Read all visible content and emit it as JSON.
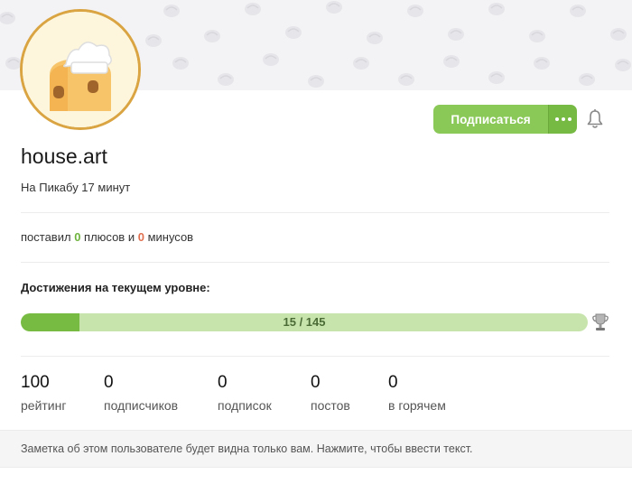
{
  "profile": {
    "username": "house.art",
    "since": "На Пикабу 17 минут"
  },
  "actions": {
    "subscribe_label": "Подписаться",
    "more_icon": "ellipsis-icon",
    "bell_icon": "bell-icon"
  },
  "votes": {
    "prefix": "поставил",
    "plus_count": "0",
    "plus_label": "плюсов и",
    "minus_count": "0",
    "minus_label": "минусов"
  },
  "achievements": {
    "title": "Достижения на текущем уровне:",
    "current": 15,
    "total": 145,
    "progress_text": "15 / 145",
    "trophy_icon": "trophy-icon"
  },
  "stats": [
    {
      "value": "100",
      "label": "рейтинг"
    },
    {
      "value": "0",
      "label": "подписчиков"
    },
    {
      "value": "0",
      "label": "подписок"
    },
    {
      "value": "0",
      "label": "постов"
    },
    {
      "value": "0",
      "label": "в горячем"
    }
  ],
  "note": {
    "text": "Заметка об этом пользователе будет видна только вам. Нажмите, чтобы ввести текст."
  },
  "colors": {
    "accent": "#8ac858",
    "accent_dark": "#76b943",
    "plus": "#6fb33f",
    "minus": "#e0704f",
    "progress_bg": "#c8e4ad",
    "progress_fill": "#77bb43"
  }
}
